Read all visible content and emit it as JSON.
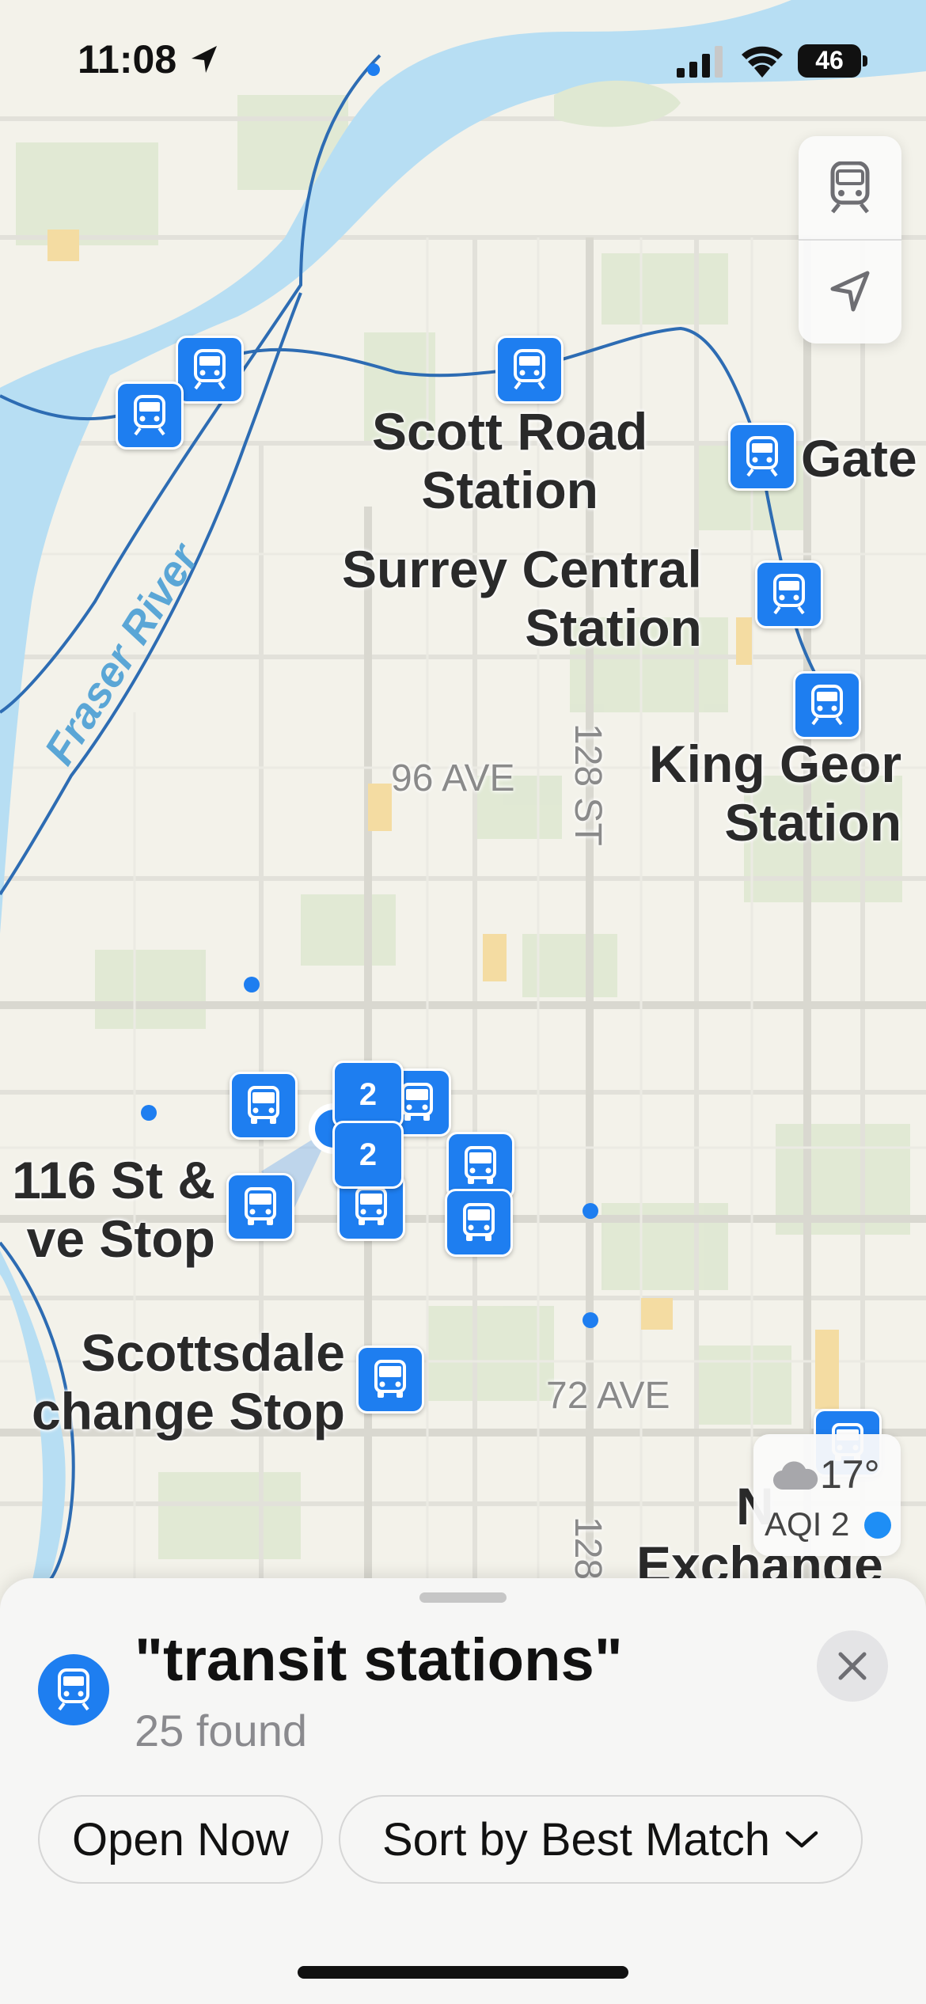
{
  "status_bar": {
    "time": "11:08",
    "battery": "46"
  },
  "map": {
    "stations": [
      {
        "name_line1": "Scott Road",
        "name_line2": "Station"
      },
      {
        "name_line1": "Surrey Central",
        "name_line2": "Station"
      },
      {
        "name_line1": "King Geor",
        "name_line2": "Station"
      },
      {
        "name_line1": "Gate"
      }
    ],
    "stops": [
      {
        "name_line1": "116 St &",
        "name_line2": "ve Stop"
      },
      {
        "name_line1": "Scottsdale",
        "name_line2": "change Stop"
      },
      {
        "name_line1": "N",
        "name_line2": "Exchange"
      }
    ],
    "roads": {
      "ave96": "96 AVE",
      "st128": "128 ST",
      "ave72": "72 AVE",
      "st128_b": "128"
    },
    "river": "Fraser River",
    "clusters": [
      "2",
      "2"
    ],
    "accent_color": "#1e7ef0"
  },
  "weather": {
    "temp": "17°",
    "aqi": "AQI 2"
  },
  "results_sheet": {
    "query": "\"transit stations\"",
    "count": "25 found",
    "filters": {
      "open_now": "Open Now",
      "sort": "Sort by Best Match"
    }
  }
}
